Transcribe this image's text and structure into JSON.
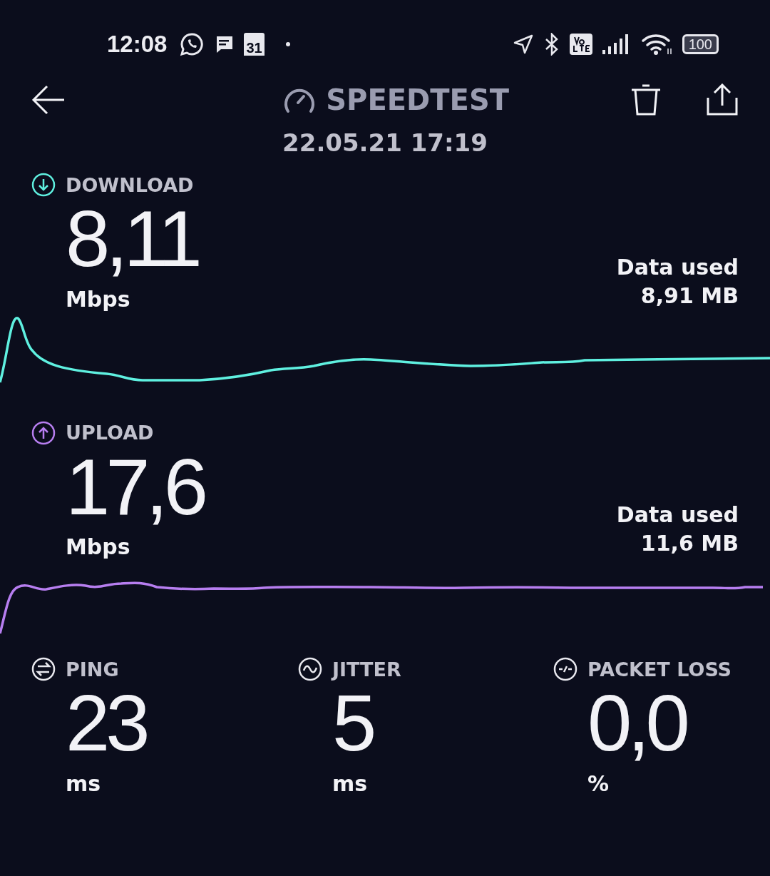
{
  "status_bar": {
    "time": "12:08",
    "calendar_day": "31",
    "battery": "100"
  },
  "header": {
    "title": "SPEEDTEST",
    "date": "22.05.21 17:19"
  },
  "speeds": [
    {
      "kind": "download",
      "label": "DOWNLOAD",
      "value": "8,11",
      "unit": "Mbps",
      "data_label": "Data used",
      "data_value": "8,91 MB",
      "color": "#5ff0e0"
    },
    {
      "kind": "upload",
      "label": "UPLOAD",
      "value": "17,6",
      "unit": "Mbps",
      "data_label": "Data used",
      "data_value": "11,6 MB",
      "color": "#b77ef0"
    }
  ],
  "metrics": [
    {
      "kind": "ping",
      "label": "PING",
      "value": "23",
      "unit": "ms"
    },
    {
      "kind": "jitter",
      "label": "JITTER",
      "value": "5",
      "unit": "ms"
    },
    {
      "kind": "packet_loss",
      "label": "PACKET LOSS",
      "value": "0,0",
      "unit": "%"
    }
  ]
}
